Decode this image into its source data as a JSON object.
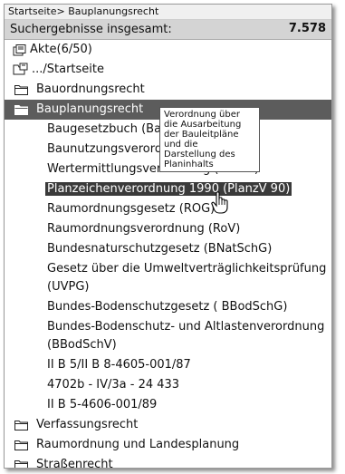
{
  "breadcrumb": "Startseite> Bauplanungsrecht",
  "summary": {
    "label": "Suchergebnisse insgesamt:",
    "value": "7.578"
  },
  "tree": {
    "akte": "Akte(6/50)",
    "startseite": ".../Startseite",
    "bauordnungsrecht": "Bauordnungsrecht",
    "bauplanungsrecht": "Bauplanungsrecht",
    "children": [
      "Baugesetzbuch (BauGB)",
      "Baunutzungsverordnung (BauNVO)",
      "Wertermittlungsverordnung (WertV)",
      "Planzeichenverordnung 1990 (PlanzV 90)",
      "Raumordnungsgesetz (ROG)",
      "Raumordnungsverordnung (RoV)",
      "Bundesnaturschutzgesetz (BNatSchG)",
      "Gesetz über die Umweltverträglichkeitsprüfung",
      "(UVPG)",
      "Bundes-Bodenschutzgesetz ( BBodSchG)",
      "Bundes-Bodenschutz- und Altlastenverordnung",
      "(BBodSchV)",
      "II B 5/II B 8-4605-001/87",
      "4702b - IV/3a - 24 433",
      "II B 5-4606-001/89"
    ],
    "verfassungsrecht": "Verfassungsrecht",
    "raumordnung": "Raumordnung und Landesplanung",
    "strassenrecht": "Straßenrecht"
  },
  "tooltip": {
    "lines": [
      "Verordnung über",
      "die Ausarbeitung",
      "der Bauleitpläne",
      "und die",
      "Darstellung des",
      "Planinhalts"
    ]
  },
  "icons": {
    "folder": "folder-icon",
    "akte": "files-icon",
    "home": "home-folder-icon",
    "cursor": "hand-cursor-icon"
  },
  "colors": {
    "selected_row": "#5c5c5c",
    "summary_bar": "#d4d4d4",
    "highlight": "#3a3a3a"
  }
}
